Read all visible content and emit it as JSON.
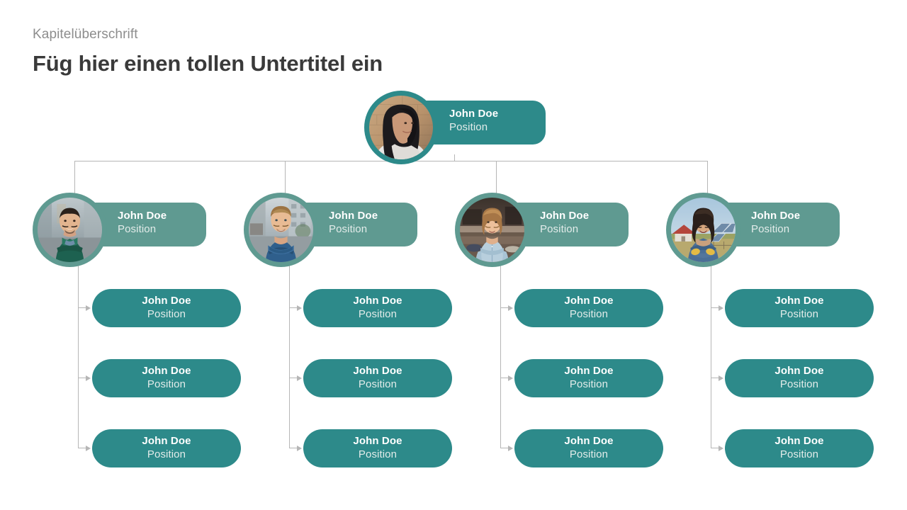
{
  "header": {
    "chapter_label": "Kapitelüberschrift",
    "title": "Füg hier einen tollen Untertitel ein"
  },
  "colors": {
    "teal_strong": "#2d8a8a",
    "teal_muted": "#5f9a91",
    "connector_gray": "#b6b6b6",
    "title_gray": "#3a3a3a",
    "label_gray": "#8d8d8d",
    "position_text": "#e3ecea"
  },
  "org_chart": {
    "root": {
      "name": "John Doe",
      "position": "Position",
      "avatar": "woman-dark-hair-brick-wall-photo"
    },
    "level2": [
      {
        "name": "John Doe",
        "position": "Position",
        "avatar": "man-green-sweater-photo"
      },
      {
        "name": "John Doe",
        "position": "Position",
        "avatar": "man-blue-shirt-arms-crossed-photo"
      },
      {
        "name": "John Doe",
        "position": "Position",
        "avatar": "woman-light-denim-shirt-photo"
      },
      {
        "name": "John Doe",
        "position": "Position",
        "avatar": "woman-denim-yellow-gloves-photo"
      }
    ],
    "level3": [
      [
        {
          "name": "John Doe",
          "position": "Position"
        },
        {
          "name": "John Doe",
          "position": "Position"
        },
        {
          "name": "John Doe",
          "position": "Position"
        }
      ],
      [
        {
          "name": "John Doe",
          "position": "Position"
        },
        {
          "name": "John Doe",
          "position": "Position"
        },
        {
          "name": "John Doe",
          "position": "Position"
        }
      ],
      [
        {
          "name": "John Doe",
          "position": "Position"
        },
        {
          "name": "John Doe",
          "position": "Position"
        },
        {
          "name": "John Doe",
          "position": "Position"
        }
      ],
      [
        {
          "name": "John Doe",
          "position": "Position"
        },
        {
          "name": "John Doe",
          "position": "Position"
        },
        {
          "name": "John Doe",
          "position": "Position"
        }
      ]
    ]
  }
}
